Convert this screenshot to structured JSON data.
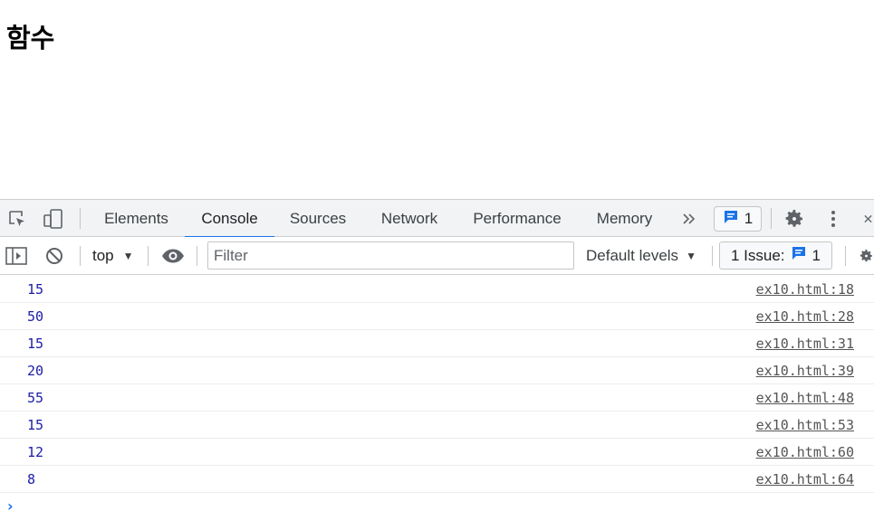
{
  "page": {
    "heading": "함수"
  },
  "devtools": {
    "tabs": [
      {
        "label": "Elements",
        "active": false
      },
      {
        "label": "Console",
        "active": true
      },
      {
        "label": "Sources",
        "active": false
      },
      {
        "label": "Network",
        "active": false
      },
      {
        "label": "Performance",
        "active": false
      },
      {
        "label": "Memory",
        "active": false
      }
    ],
    "more_tabs_icon": "double-chevron-right-icon",
    "messages_count": "1",
    "accent_color": "#1a73e8",
    "console_toolbar": {
      "context": "top",
      "filter_placeholder": "Filter",
      "filter_value": "",
      "levels": "Default levels",
      "issues_label": "1 Issue:",
      "issues_count": "1"
    },
    "console_log": [
      {
        "value": "15",
        "source": "ex10.html:18"
      },
      {
        "value": "50",
        "source": "ex10.html:28"
      },
      {
        "value": "15",
        "source": "ex10.html:31"
      },
      {
        "value": "20",
        "source": "ex10.html:39"
      },
      {
        "value": "55",
        "source": "ex10.html:48"
      },
      {
        "value": "15",
        "source": "ex10.html:53"
      },
      {
        "value": "12",
        "source": "ex10.html:60"
      },
      {
        "value": "8",
        "source": "ex10.html:64"
      }
    ],
    "value_color": "#1c1ca8"
  }
}
